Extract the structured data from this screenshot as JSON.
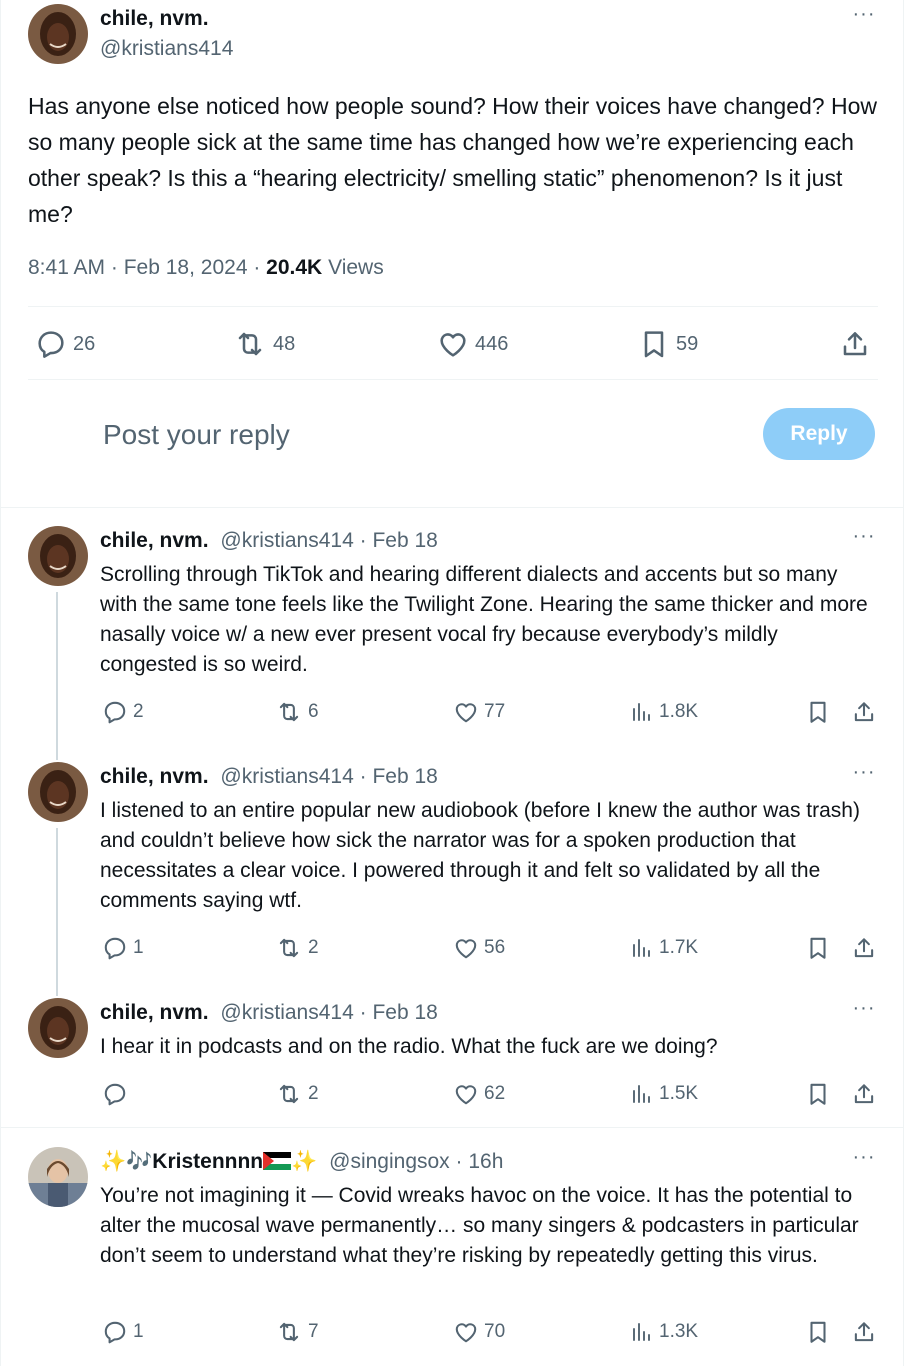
{
  "main_post": {
    "display_name": "chile, nvm.",
    "handle": "@kristians414",
    "text": "Has anyone else noticed how people sound? How their voices have changed? How so many people sick at the same time has changed how we’re experiencing each other speak? Is this a “hearing electricity/ smelling static” phenomenon? Is it just me?",
    "time": "8:41 AM",
    "date": "Feb 18, 2024",
    "views_count": "20.4K",
    "views_label": "Views",
    "replies": "26",
    "reposts": "48",
    "likes": "446",
    "bookmarks": "59"
  },
  "composer": {
    "placeholder": "Post your reply",
    "button_label": "Reply",
    "button_color": "#8ecdf8"
  },
  "replies": [
    {
      "display_name": "chile, nvm.",
      "handle": "@kristians414",
      "time": "Feb 18",
      "text": "Scrolling through TikTok and hearing different dialects and accents but so many with the same tone feels like the Twilight Zone.  Hearing the same thicker and more nasally voice w/ a new ever present vocal fry because everybody’s mildly congested is so weird.",
      "replies": "2",
      "reposts": "6",
      "likes": "77",
      "views": "1.8K"
    },
    {
      "display_name": "chile, nvm.",
      "handle": "@kristians414",
      "time": "Feb 18",
      "text": "I listened to an entire popular new audiobook (before I knew the author was trash) and couldn’t believe how sick the narrator was for a spoken production that necessitates a clear voice. I powered through it and felt so validated by all the comments saying wtf.",
      "replies": "1",
      "reposts": "2",
      "likes": "56",
      "views": "1.7K"
    },
    {
      "display_name": "chile, nvm.",
      "handle": "@kristians414",
      "time": "Feb 18",
      "text": "I hear it in podcasts and on the radio. What the fuck are we doing?",
      "replies": "",
      "reposts": "2",
      "likes": "62",
      "views": "1.5K"
    },
    {
      "display_name_pre": "✨🎶",
      "display_name": "Kristennnn",
      "display_name_post": "✨",
      "handle": "@singingsox",
      "time": "16h",
      "text": "You’re not imagining it — Covid wreaks havoc on the voice. It has the potential to alter the mucosal wave permanently… so many singers & podcasters in particular don’t seem to understand what they’re risking by repeatedly getting this virus.",
      "replies": "1",
      "reposts": "7",
      "likes": "70",
      "views": "1.3K"
    }
  ],
  "icons": [
    "reply-icon",
    "repost-icon",
    "like-icon",
    "views-icon",
    "bookmark-icon",
    "share-icon",
    "more-icon",
    "palestine-flag-icon"
  ],
  "colors": {
    "text": "#0f1419",
    "muted": "#536471",
    "divider": "#eff3f4",
    "thread_line": "#cfd9de"
  }
}
